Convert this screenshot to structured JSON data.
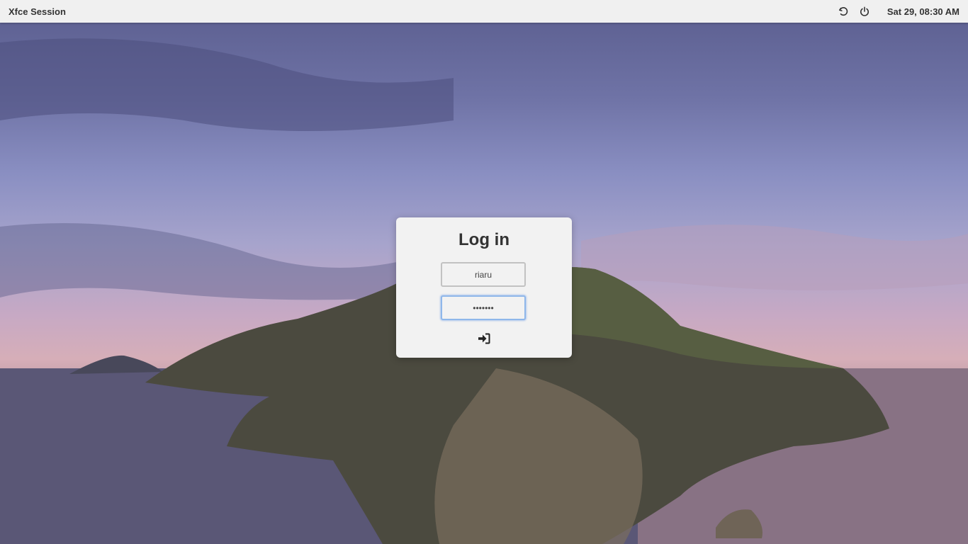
{
  "panel": {
    "session_label": "Xfce Session",
    "restart_icon": "restart-icon",
    "power_icon": "power-icon",
    "clock": "Sat 29, 08:30 AM"
  },
  "login": {
    "title": "Log in",
    "username_value": "riaru",
    "password_value": "•••••••",
    "submit_icon": "sign-in-icon"
  },
  "colors": {
    "panel_bg": "#f0f0f0",
    "card_bg": "#f2f2f2",
    "focus_border": "#8fb7ea"
  }
}
